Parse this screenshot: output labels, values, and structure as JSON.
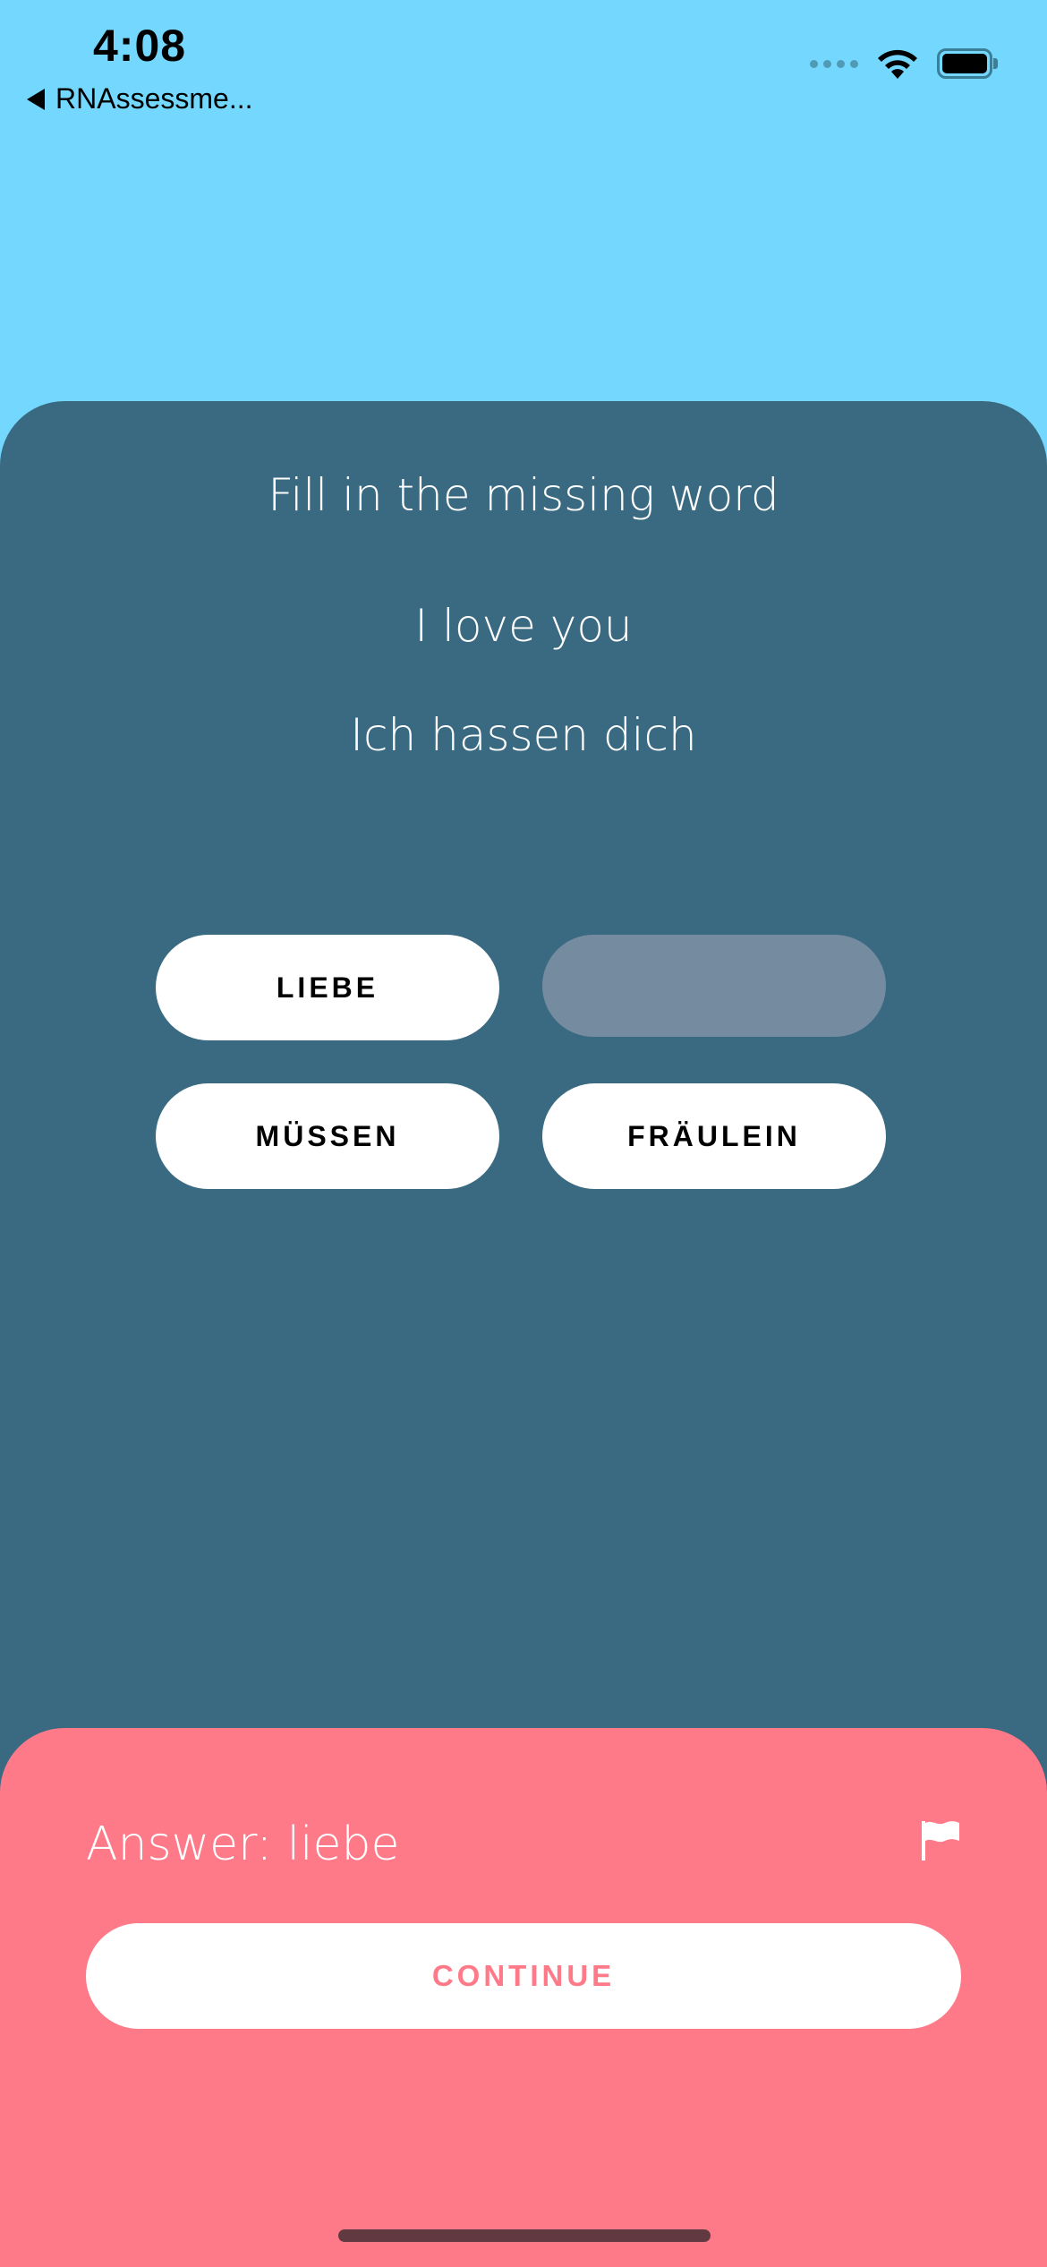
{
  "status_bar": {
    "time": "4:08",
    "back_label": "RNAssessme..."
  },
  "exercise": {
    "title": "Fill in the missing word",
    "source_sentence": "I love you",
    "target_sentence": "Ich hassen dich",
    "options": [
      {
        "label": "LIEBE",
        "state": "available"
      },
      {
        "label": "",
        "state": "used"
      },
      {
        "label": "MÜSSEN",
        "state": "available"
      },
      {
        "label": "FRÄULEIN",
        "state": "available"
      }
    ]
  },
  "answer_panel": {
    "answer_text": "Answer: liebe",
    "continue_label": "CONTINUE",
    "flag_icon": "flag-icon"
  },
  "colors": {
    "sky_background": "#74D7FD",
    "card_background": "#3A6A81",
    "answer_panel": "#FF7A89",
    "empty_slot": "#758BA0"
  }
}
